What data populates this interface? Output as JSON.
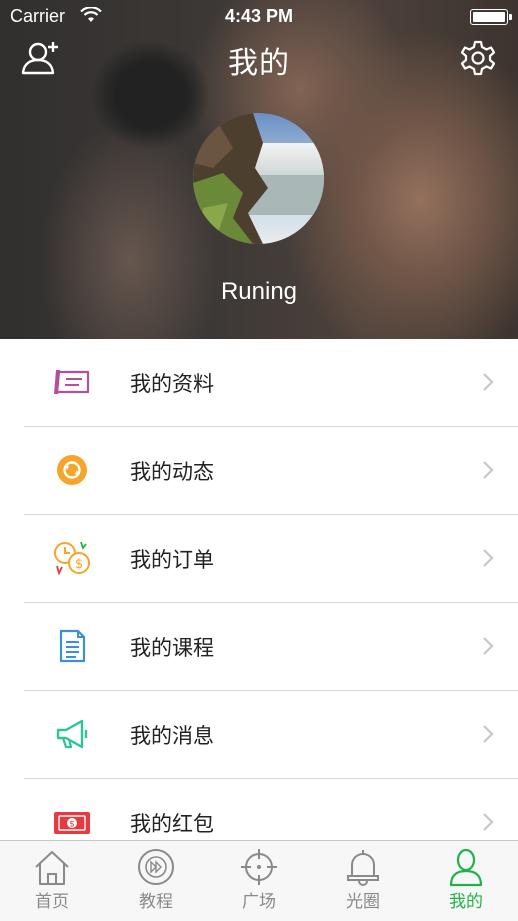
{
  "status_bar": {
    "carrier": "Carrier",
    "time": "4:43 PM"
  },
  "header": {
    "title": "我的",
    "add_user_icon": "add-user-icon",
    "settings_icon": "gear-icon"
  },
  "profile": {
    "username": "Runing"
  },
  "menu": {
    "items": [
      {
        "label": "我的资料",
        "icon": "profile-card-icon",
        "color": "#b4509a"
      },
      {
        "label": "我的动态",
        "icon": "activity-icon",
        "color": "#f5a52a"
      },
      {
        "label": "我的订单",
        "icon": "order-clock-dollar-icon",
        "color": "#f5a52a"
      },
      {
        "label": "我的课程",
        "icon": "course-document-icon",
        "color": "#3a8fd8"
      },
      {
        "label": "我的消息",
        "icon": "megaphone-icon",
        "color": "#2cc49a"
      },
      {
        "label": "我的红包",
        "icon": "red-packet-icon",
        "color": "#e8393f"
      }
    ]
  },
  "tabbar": {
    "tabs": [
      {
        "label": "首页",
        "icon": "home-icon"
      },
      {
        "label": "教程",
        "icon": "play-forward-icon"
      },
      {
        "label": "广场",
        "icon": "crosshair-icon"
      },
      {
        "label": "光圈",
        "icon": "bell-icon"
      },
      {
        "label": "我的",
        "icon": "person-icon",
        "active": true
      }
    ],
    "active_color": "#20b24a",
    "inactive_color": "#8a8a8a"
  }
}
